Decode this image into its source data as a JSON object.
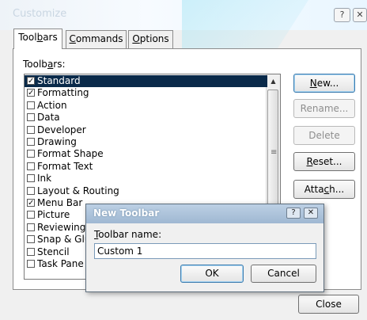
{
  "window": {
    "title": "Customize",
    "help_glyph": "?",
    "close_glyph": "✕"
  },
  "tabs": [
    {
      "label_pre": "Tool",
      "label_key": "b",
      "label_post": "ars"
    },
    {
      "label_pre": "",
      "label_key": "C",
      "label_post": "ommands"
    },
    {
      "label_pre": "",
      "label_key": "O",
      "label_post": "ptions"
    }
  ],
  "toolbars_label": {
    "pre": "Toolb",
    "key": "a",
    "post": "rs:"
  },
  "toolbar_list": [
    {
      "label": "Standard",
      "checked": true,
      "selected": true
    },
    {
      "label": "Formatting",
      "checked": true,
      "selected": false
    },
    {
      "label": "Action",
      "checked": false,
      "selected": false
    },
    {
      "label": "Data",
      "checked": false,
      "selected": false
    },
    {
      "label": "Developer",
      "checked": false,
      "selected": false
    },
    {
      "label": "Drawing",
      "checked": false,
      "selected": false
    },
    {
      "label": "Format Shape",
      "checked": false,
      "selected": false
    },
    {
      "label": "Format Text",
      "checked": false,
      "selected": false
    },
    {
      "label": "Ink",
      "checked": false,
      "selected": false
    },
    {
      "label": "Layout & Routing",
      "checked": false,
      "selected": false
    },
    {
      "label": "Menu Bar",
      "checked": true,
      "selected": false
    },
    {
      "label": "Picture",
      "checked": false,
      "selected": false
    },
    {
      "label": "Reviewing",
      "checked": false,
      "selected": false
    },
    {
      "label": "Snap & Glue",
      "checked": false,
      "selected": false
    },
    {
      "label": "Stencil",
      "checked": false,
      "selected": false
    },
    {
      "label": "Task Pane",
      "checked": false,
      "selected": false
    }
  ],
  "check_glyph": "✓",
  "scroll": {
    "up": "▲",
    "grip": "≡"
  },
  "buttons": {
    "new": {
      "pre": "",
      "key": "N",
      "post": "ew..."
    },
    "rename": "Rename...",
    "delete": "Delete",
    "reset": {
      "pre": "",
      "key": "R",
      "post": "eset..."
    },
    "attach": {
      "pre": "Atta",
      "key": "c",
      "post": "h..."
    },
    "close": "Close"
  },
  "modal": {
    "title": "New Toolbar",
    "help_glyph": "?",
    "close_glyph": "✕",
    "label": {
      "pre": "",
      "key": "T",
      "post": "oolbar name:"
    },
    "input_value": "Custom 1",
    "ok": "OK",
    "cancel": "Cancel"
  }
}
